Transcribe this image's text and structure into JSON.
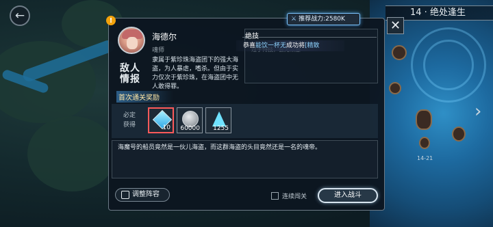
{
  "stage": {
    "title": "14 · 绝处逢生",
    "node_label": "14-21"
  },
  "power_tag": {
    "text": "推荐战力:2580K"
  },
  "enemy": {
    "badge": "敌人\n情报",
    "name": "海德尔",
    "title": "魂师",
    "description": "隶属于紫珍珠海盗团下的强大海盗，为人暴虐，嗜杀。但由于实力仅次于紫珍珠，在海盗团中无人敢得罪。"
  },
  "skill": {
    "title": "绝技",
    "ghost_text": "过于恃技，会无法感"
  },
  "toast": {
    "prefix": "恭喜",
    "highlight": "能饮一杯无",
    "middle": "成功将",
    "suffix": "[精致"
  },
  "reward": {
    "header": "首次通关奖励",
    "label": "必定\n获得",
    "items": [
      {
        "icon": "gem-icon",
        "count": "10"
      },
      {
        "icon": "silver-coin-icon",
        "count": "60000"
      },
      {
        "icon": "crystal-icon",
        "count": "1255"
      }
    ]
  },
  "story": "海魔号的船员竟然是一伙儿海盗，而这群海盗的头目竟然还是一名的魂帝。",
  "controls": {
    "formation": "调整阵容",
    "auto": "连续闯关",
    "enter": "进入战斗",
    "back": "←",
    "close": "✕",
    "warning": "!",
    "next": "›"
  },
  "colors": {
    "accent": "#7dc6ff",
    "reward_header": "#ffe7a6",
    "warning": "#f2a20c"
  }
}
